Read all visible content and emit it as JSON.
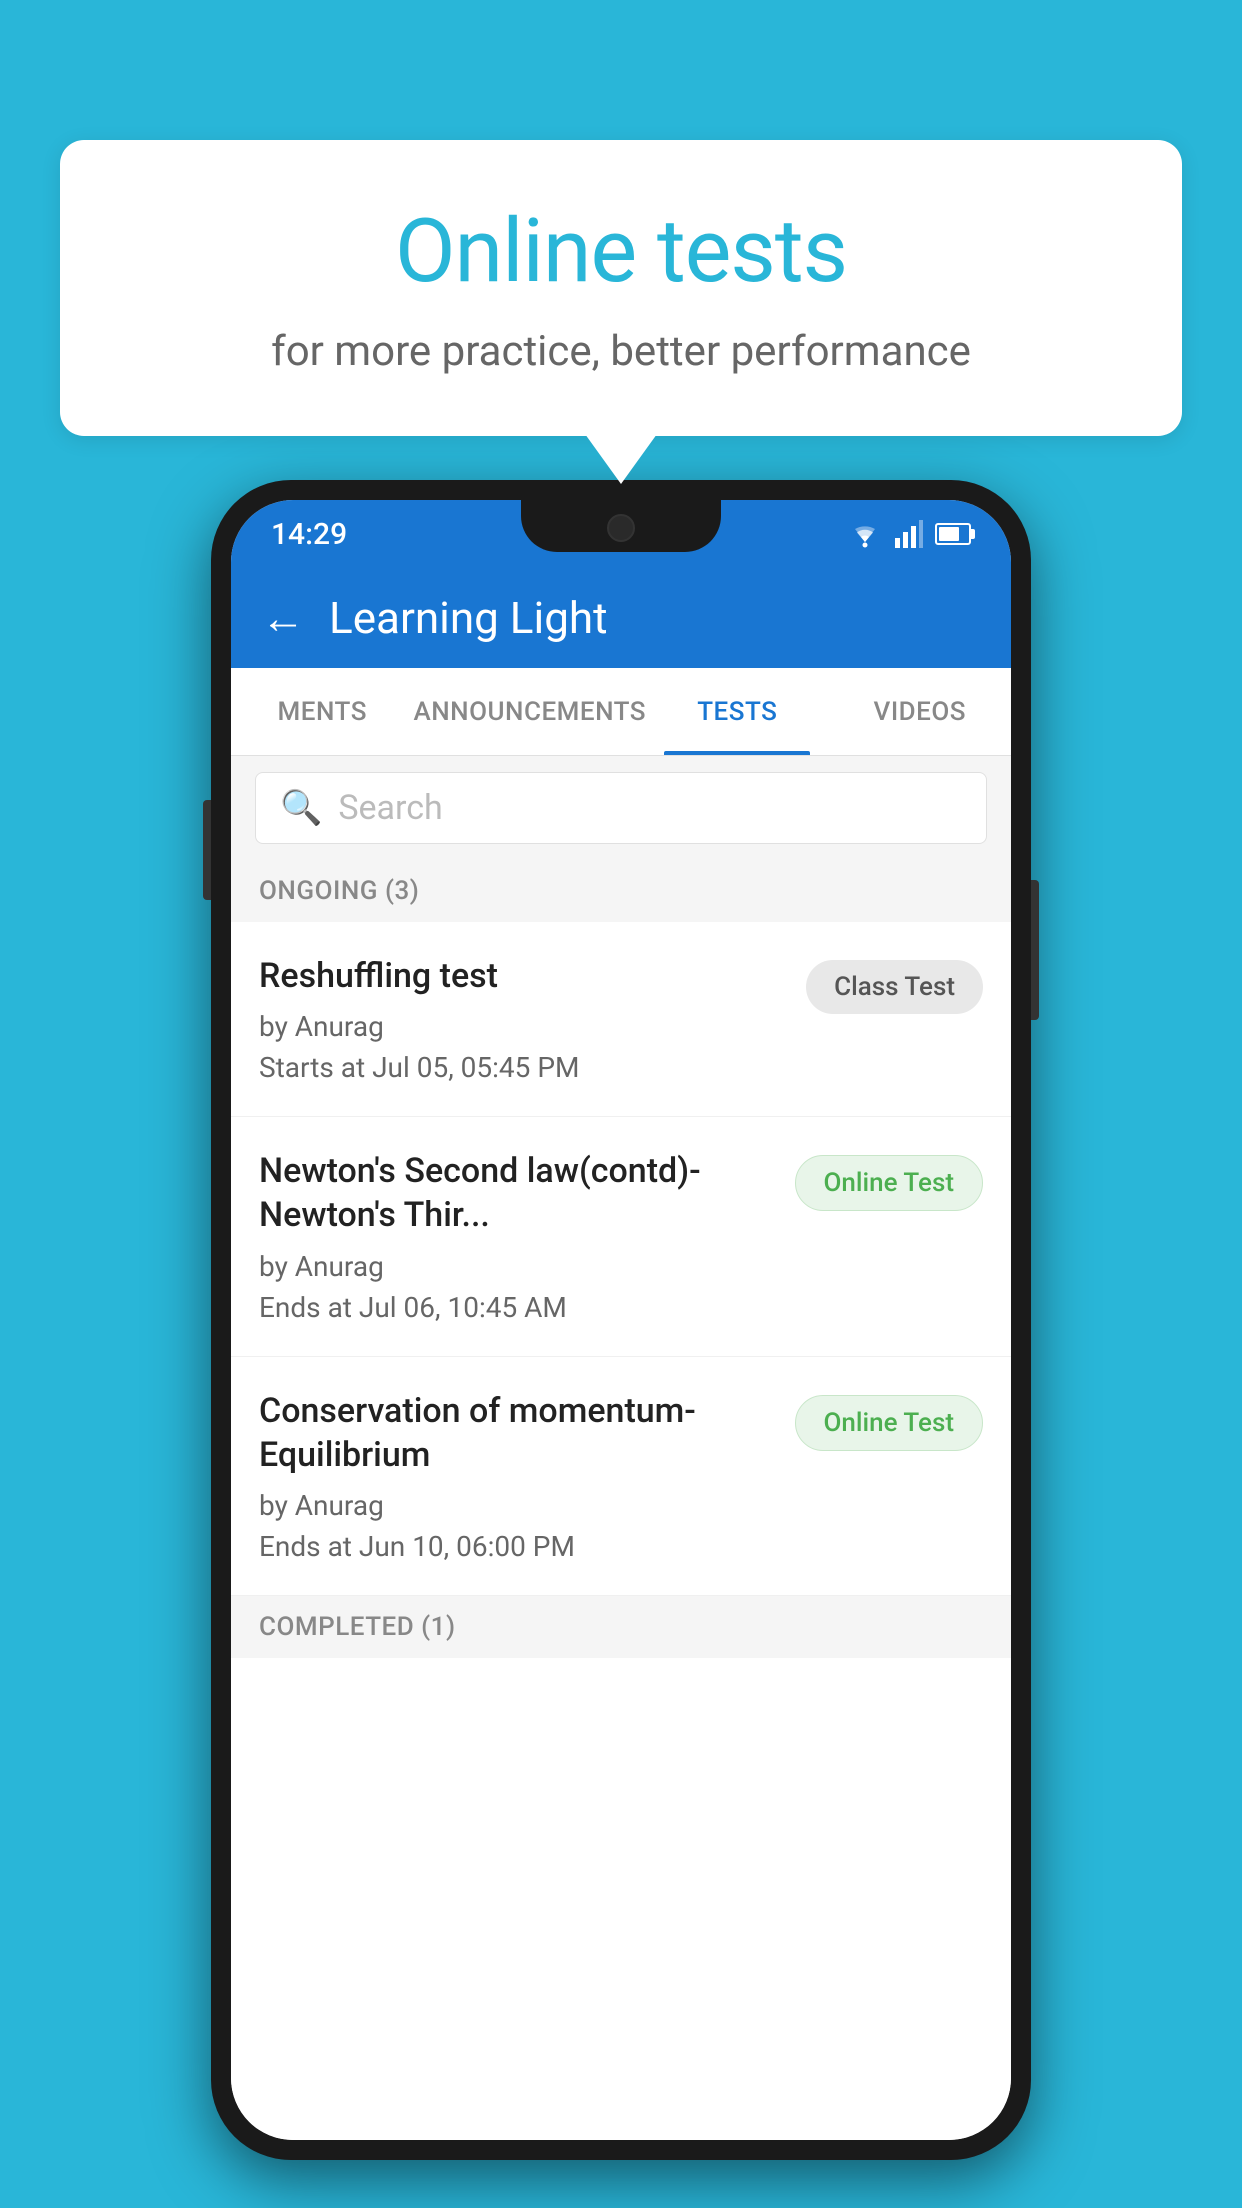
{
  "background": {
    "color": "#29b6d8"
  },
  "speech_bubble": {
    "title": "Online tests",
    "subtitle": "for more practice, better performance"
  },
  "phone": {
    "status_bar": {
      "time": "14:29"
    },
    "app_bar": {
      "title": "Learning Light",
      "back_label": "←"
    },
    "tabs": [
      {
        "id": "ments",
        "label": "MENTS",
        "active": false
      },
      {
        "id": "announcements",
        "label": "ANNOUNCEMENTS",
        "active": false
      },
      {
        "id": "tests",
        "label": "TESTS",
        "active": true
      },
      {
        "id": "videos",
        "label": "VIDEOS",
        "active": false
      }
    ],
    "search": {
      "placeholder": "Search"
    },
    "ongoing_section": {
      "label": "ONGOING (3)"
    },
    "tests": [
      {
        "id": "test-1",
        "name": "Reshuffling test",
        "by": "by Anurag",
        "date": "Starts at  Jul 05, 05:45 PM",
        "badge": "Class Test",
        "badge_type": "class"
      },
      {
        "id": "test-2",
        "name": "Newton's Second law(contd)-Newton's Thir...",
        "by": "by Anurag",
        "date": "Ends at  Jul 06, 10:45 AM",
        "badge": "Online Test",
        "badge_type": "online"
      },
      {
        "id": "test-3",
        "name": "Conservation of momentum-Equilibrium",
        "by": "by Anurag",
        "date": "Ends at  Jun 10, 06:00 PM",
        "badge": "Online Test",
        "badge_type": "online"
      }
    ],
    "completed_section": {
      "label": "COMPLETED (1)"
    }
  }
}
